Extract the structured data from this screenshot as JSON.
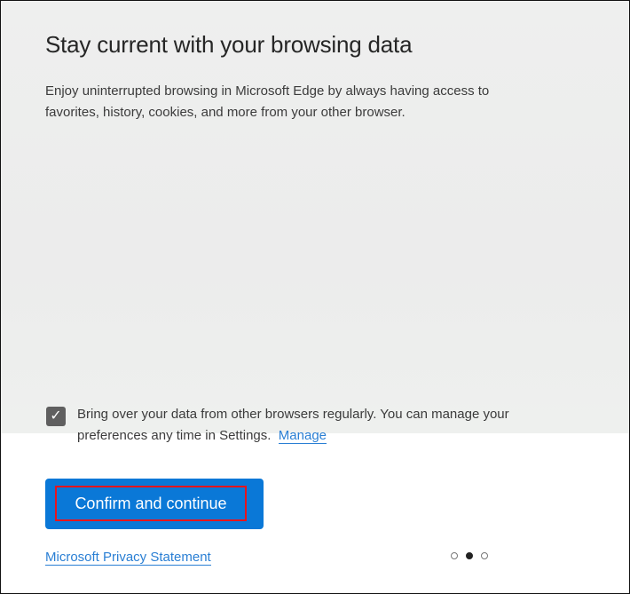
{
  "title": "Stay current with your browsing data",
  "description": "Enjoy uninterrupted browsing in Microsoft Edge by always having access to favorites, history, cookies, and more from your other browser.",
  "checkbox": {
    "checked": true,
    "label": "Bring over your data from other browsers regularly. You can manage your preferences any time in Settings.",
    "link": "Manage"
  },
  "button": {
    "label": "Confirm and continue",
    "color": "#0a78d7"
  },
  "privacy_link": "Microsoft Privacy Statement",
  "pager": {
    "total": 3,
    "current": 2
  }
}
